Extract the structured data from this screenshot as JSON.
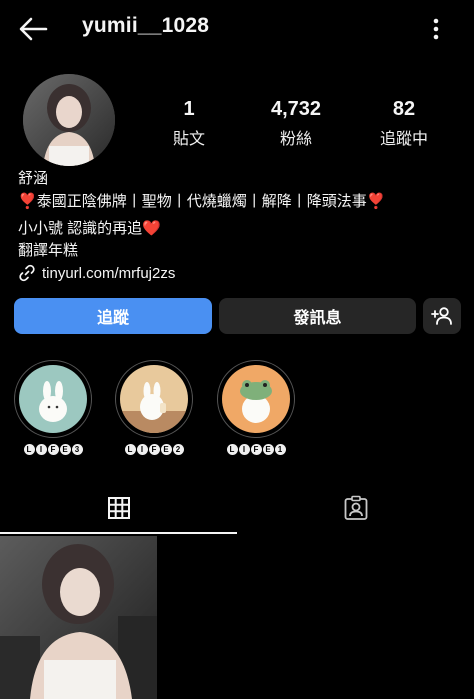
{
  "header": {
    "username": "yumii__1028",
    "back_icon": "arrow-left-icon",
    "more_icon": "more-vertical-icon"
  },
  "stats": [
    {
      "value": "1",
      "label": "貼文"
    },
    {
      "value": "4,732",
      "label": "粉絲"
    },
    {
      "value": "82",
      "label": "追蹤中"
    }
  ],
  "bio": {
    "name": "舒涵",
    "line1_heart_left": "❣️",
    "line1_text": "泰國正陰佛牌丨聖物丨代燒蠟燭丨解降丨降頭法事",
    "line1_heart_right": "❣️",
    "line2_text": "小小號 認識的再追",
    "line2_heart": "❤️",
    "line3_text": "翻譯年糕",
    "link": "tinyurl.com/mrfuj2zs"
  },
  "actions": {
    "follow_label": "追蹤",
    "message_label": "發訊息",
    "add_user_icon": "person-plus-icon"
  },
  "highlights": [
    {
      "chars": [
        "L",
        "I",
        "F",
        "E",
        "3"
      ]
    },
    {
      "chars": [
        "L",
        "I",
        "F",
        "E",
        "2"
      ]
    },
    {
      "chars": [
        "L",
        "I",
        "F",
        "E",
        "1"
      ]
    }
  ],
  "tabs": {
    "grid_icon": "grid-icon",
    "tagged_icon": "tagged-person-icon"
  },
  "colors": {
    "background": "#000000",
    "follow_button": "#4a90f2",
    "secondary_button": "#262626",
    "heart": "#e0245e"
  }
}
